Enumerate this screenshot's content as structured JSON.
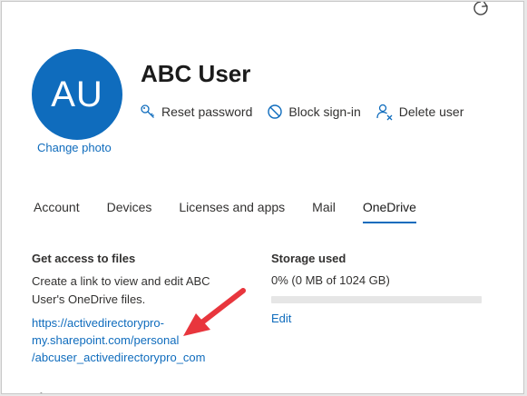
{
  "user": {
    "initials": "AU",
    "name": "ABC User",
    "change_photo": "Change photo"
  },
  "actions": [
    {
      "label": "Reset password",
      "icon": "key-icon"
    },
    {
      "label": "Block sign-in",
      "icon": "block-icon"
    },
    {
      "label": "Delete user",
      "icon": "delete-user-icon"
    }
  ],
  "tabs": [
    {
      "label": "Account"
    },
    {
      "label": "Devices"
    },
    {
      "label": "Licenses and apps"
    },
    {
      "label": "Mail"
    },
    {
      "label": "OneDrive",
      "active": true
    }
  ],
  "files": {
    "title": "Get access to files",
    "description": "Create a link to view and edit ABC User's OneDrive files.",
    "link_line1": "https://activedirectorypro-",
    "link_line2": "my.sharepoint.com/personal",
    "link_line3": "/abcuser_activedirectorypro_com"
  },
  "storage": {
    "title": "Storage used",
    "usage_text": "0% (0 MB of 1024 GB)",
    "percent": 0,
    "edit_label": "Edit"
  },
  "cut_off_heading": "Sh",
  "colors": {
    "accent": "#0f6cbd",
    "annotation_arrow": "#e8363d"
  }
}
